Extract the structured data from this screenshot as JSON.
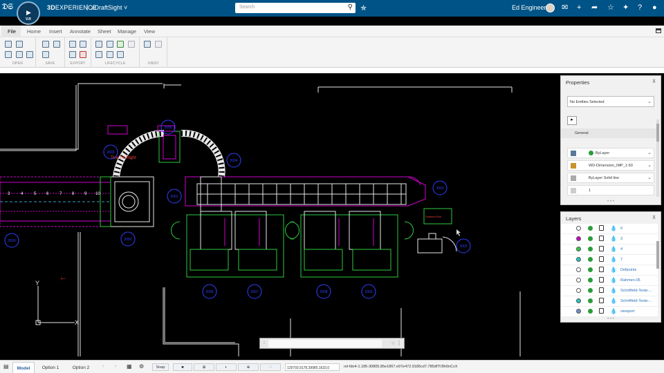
{
  "topbar": {
    "brand_prefix": "3D",
    "brand": "EXPERIENCE",
    "separator": "|",
    "app": "xDraftSight",
    "app_chevron": "˅",
    "search_placeholder": "Search",
    "user": "Ed Engineer",
    "compass_version": "V.R",
    "icons": [
      "compass-icon",
      "search-icon",
      "tag-icon",
      "share-icon",
      "add-icon",
      "share-arrow-icon",
      "network-icon",
      "tools-icon",
      "help-icon",
      "user-menu-icon"
    ]
  },
  "menu": {
    "items": [
      "File",
      "Home",
      "Insert",
      "Annotate",
      "Sheet",
      "Manage",
      "View"
    ]
  },
  "ribbon": {
    "groups": [
      "OPEN",
      "SAVE",
      "EXPORT",
      "LIFECYCLE",
      "UNDO"
    ]
  },
  "canvas": {
    "numbers": [
      "3",
      "4",
      "5",
      "6",
      "7",
      "8",
      "9",
      "10"
    ],
    "bubbles": [
      "2000",
      "2005",
      "2003",
      "2004",
      "2001",
      "2002",
      "2006",
      "2007",
      "2008",
      "2003",
      "2003",
      "2002",
      "2005",
      "2080"
    ],
    "ucs_x": "X",
    "ucs_y": "Y",
    "label_red": "Scanner Exit",
    "label_green": "Exit Conveyor"
  },
  "properties": {
    "title": "Properties",
    "selection": "No Entities Selected",
    "section": "General",
    "rows": [
      "ByLayer",
      "WD-Dimension_IMP_1-50",
      "ByLayer Solid line",
      "1"
    ]
  },
  "layers": {
    "title": "Layers",
    "rows": [
      {
        "name": "0",
        "color": "#ffffff"
      },
      {
        "name": "3",
        "color": "#c800c8"
      },
      {
        "name": "4",
        "color": "#2ecc40"
      },
      {
        "name": "7",
        "color": "#27c4c4"
      },
      {
        "name": "Defpoints",
        "color": "#ffffff"
      },
      {
        "name": "Rahmen-05",
        "color": "#ffffff"
      },
      {
        "name": "Schriftfeld-Texte-...",
        "color": "#ffffff"
      },
      {
        "name": "Schriftfeld-Texte-...",
        "color": "#27c4c4"
      },
      {
        "name": "viewport",
        "color": "#6f8fd0"
      }
    ]
  },
  "cmdline": {
    "prompt": ":"
  },
  "status": {
    "tabs": [
      "Model",
      "Option 1",
      "Option 2"
    ],
    "snap": "Snap",
    "coords": "129793.9178,39985.1633,0",
    "rel": "rel-fdo4-1.185-30805.85e1867.e97e472.9185cd7.785df7f.Bh0nCvX"
  },
  "colors": {
    "topbar": "#005386",
    "canvas": "#000000",
    "cad_green": "#2ecc40",
    "cad_magenta": "#d000d0",
    "cad_blue": "#3040ff",
    "cad_white": "#ffffff"
  }
}
